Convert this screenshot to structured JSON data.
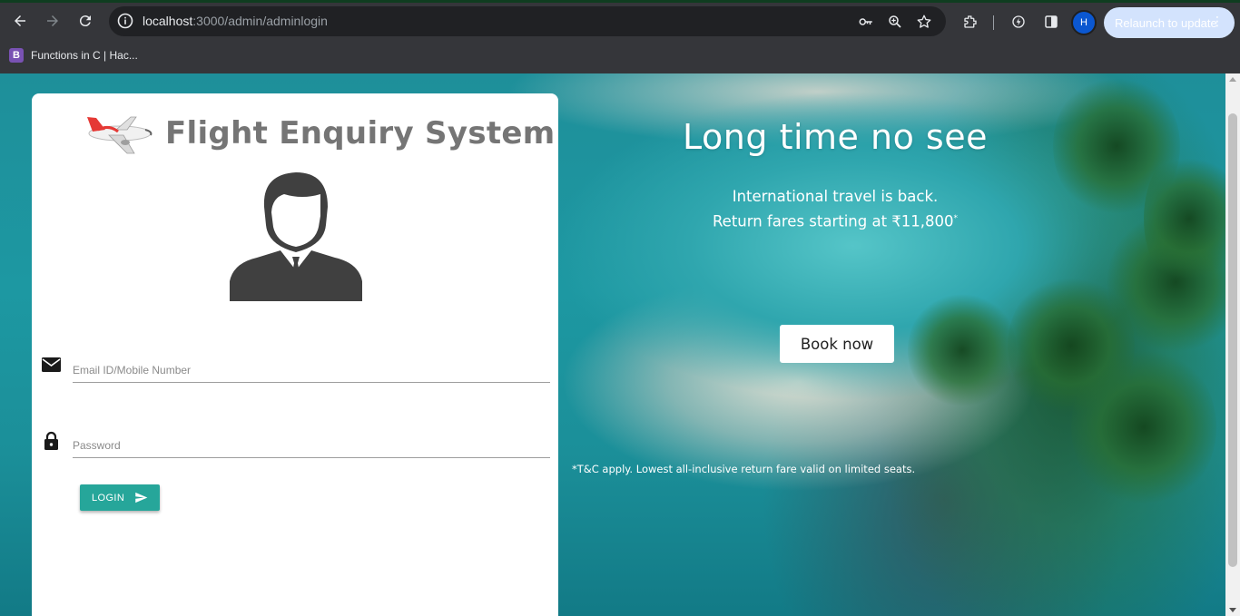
{
  "browser": {
    "url_host": "localhost",
    "url_path": ":3000/admin/adminlogin",
    "profile_initial": "H",
    "relaunch_label": "Relaunch to update",
    "bookmark": {
      "favicon_letter": "B",
      "label": "Functions in C | Hac..."
    }
  },
  "login_card": {
    "title": "Flight Enquiry System",
    "email_placeholder": "Email ID/Mobile Number",
    "password_placeholder": "Password",
    "login_label": "LOGIN"
  },
  "promo": {
    "title": "Long time no see",
    "subtitle_line1": "International travel is back.",
    "subtitle_line2": "Return fares starting at ₹11,800",
    "subtitle_mark": "*",
    "book_label": "Book now",
    "tnc": "*T&C apply. Lowest all-inclusive return fare valid on limited seats."
  },
  "colors": {
    "accent": "#26a69a",
    "title_gray": "#757575",
    "sea": "#1e8f9a"
  }
}
